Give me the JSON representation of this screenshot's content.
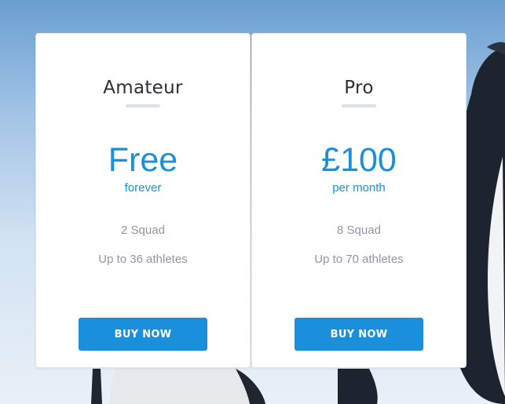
{
  "plans": [
    {
      "name": "Amateur",
      "price": "Free",
      "period": "forever",
      "features": [
        "2 Squad",
        "Up to 36 athletes"
      ],
      "button_label": "BUY NOW"
    },
    {
      "name": "Pro",
      "price": "£100",
      "period": "per month",
      "features": [
        "8 Squad",
        "Up to 70 athletes"
      ],
      "button_label": "BUY NOW"
    }
  ],
  "colors": {
    "accent": "#1a8fdc",
    "card_background": "#ffffff",
    "feature_text": "#8e98a1",
    "title_text": "#2b2f33"
  }
}
